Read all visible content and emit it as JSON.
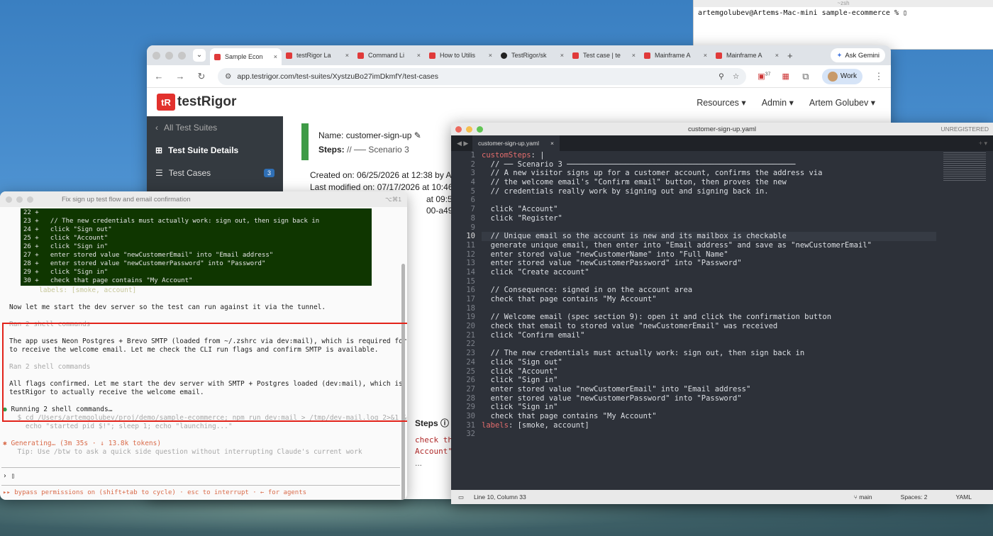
{
  "terminal_top": {
    "title": "~zsh",
    "prompt": "artemgolubev@Artems-Mac-mini sample-ecommerce % "
  },
  "browser": {
    "tabs": [
      {
        "label": "Sample Econ",
        "icon": "testrigor"
      },
      {
        "label": "testRigor La",
        "icon": "testrigor"
      },
      {
        "label": "Command Li",
        "icon": "testrigor"
      },
      {
        "label": "How to Utilis",
        "icon": "testrigor"
      },
      {
        "label": "TestRigor/sk",
        "icon": "github"
      },
      {
        "label": "Test case | te",
        "icon": "testrigor"
      },
      {
        "label": "Mainframe A",
        "icon": "testrigor"
      },
      {
        "label": "Mainframe A",
        "icon": "testrigor"
      }
    ],
    "ask_gemini": "Ask Gemini",
    "url": "app.testrigor.com/test-suites/XystzuBo27imDkmfY/test-cases",
    "work_label": "Work",
    "ext_badge": "37"
  },
  "app": {
    "logo_mark": "tR",
    "logo_text": "testRigor",
    "nav": [
      "Resources ▾",
      "Admin ▾",
      "Artem Golubev ▾"
    ],
    "sidebar": {
      "back": "All Test Suites",
      "details": "Test Suite Details",
      "cases": "Test Cases",
      "cases_count": "3"
    },
    "main": {
      "name_label": "Name:",
      "name_value": "customer-sign-up",
      "steps_label": "Steps:",
      "steps_value": "// ── Scenario 3",
      "created": "Created on: 06/25/2026 at 12:38  by  A",
      "modified": "Last modified on: 07/17/2026 at 10:46",
      "run": "at 09:51  by",
      "id": "00-a493-8e",
      "steps_header": "Steps",
      "check_text": "check th",
      "account_text": "Account\"",
      "ellipsis": "..."
    }
  },
  "sublime": {
    "title": "customer-sign-up.yaml",
    "unregistered": "UNREGISTERED",
    "tab_label": "customer-sign-up.yaml",
    "current_line": 10,
    "lines": [
      "customSteps: |",
      "  // ── Scenario 3 ───────────────────────────────────────────────────",
      "  // A new visitor signs up for a customer account, confirms the address via",
      "  // the welcome email's \"Confirm email\" button, then proves the new",
      "  // credentials really work by signing out and signing back in.",
      "",
      "  click \"Account\"",
      "  click \"Register\"",
      "",
      "  // Unique email so the account is new and its mailbox is checkable",
      "  generate unique email, then enter into \"Email address\" and save as \"newCustomerEmail\"",
      "  enter stored value \"newCustomerName\" into \"Full Name\"",
      "  enter stored value \"newCustomerPassword\" into \"Password\"",
      "  click \"Create account\"",
      "",
      "  // Consequence: signed in on the account area",
      "  check that page contains \"My Account\"",
      "",
      "  // Welcome email (spec section 9): open it and click the confirmation button",
      "  check that email to stored value \"newCustomerEmail\" was received",
      "  click \"Confirm email\"",
      "",
      "  // The new credentials must actually work: sign out, then sign back in",
      "  click \"Sign out\"",
      "  click \"Account\"",
      "  click \"Sign in\"",
      "  enter stored value \"newCustomerEmail\" into \"Email address\"",
      "  enter stored value \"newCustomerPassword\" into \"Password\"",
      "  click \"Sign in\"",
      "  check that page contains \"My Account\"",
      "labels: [smoke, account]",
      ""
    ],
    "status_pos": "Line 10, Column 33",
    "status_branch": "main",
    "status_spaces": "Spaces: 2",
    "status_syntax": "YAML"
  },
  "claude": {
    "title": "Fix sign up test flow and email confirmation",
    "shortcut": "⌥⌘1",
    "diff": [
      "22 +",
      "23 +   // The new credentials must actually work: sign out, then sign back in",
      "24 +   click \"Sign out\"",
      "25 +   click \"Account\"",
      "26 +   click \"Sign in\"",
      "27 +   enter stored value \"newCustomerEmail\" into \"Email address\"",
      "28 +   enter stored value \"newCustomerPassword\" into \"Password\"",
      "29 +   click \"Sign in\"",
      "30 +   check that page contains \"My Account\""
    ],
    "labels_line": "labels: [smoke, account]",
    "msg1": "Now let me start the dev server so the test can run against it via the tunnel.",
    "ran1": "Ran 2 shell commands",
    "msg2a": "The app uses Neon Postgres + Brevo SMTP (loaded from ~/.zshrc via dev:mail), which is required for testRigor",
    "msg2b": "to receive the welcome email. Let me check the CLI run flags and confirm SMTP is available.",
    "ran2": "Ran 2 shell commands",
    "msg3a": "All flags confirmed. Let me start the dev server with SMTP + Postgres loaded (dev:mail), which is required for",
    "msg3b": "testRigor to actually receive the welcome email.",
    "running": "Running 2 shell commands…",
    "cmd1": "  $ cd /Users/artemgolubev/proj/demo/sample-ecommerce; npm run dev:mail > /tmp/dev-mail.log 2>&1 &",
    "cmd2": "    echo \"started pid $!\"; sleep 1; echo \"launching...\"",
    "generating": "Generating… (3m 35s · ↓ 13.8k tokens)",
    "tip": "  Tip: Use /btw to ask a quick side question without interrupting Claude's current work",
    "prompt": "› ",
    "footer": "▸▸ bypass permissions on (shift+tab to cycle) · esc to interrupt · ← for agents"
  }
}
